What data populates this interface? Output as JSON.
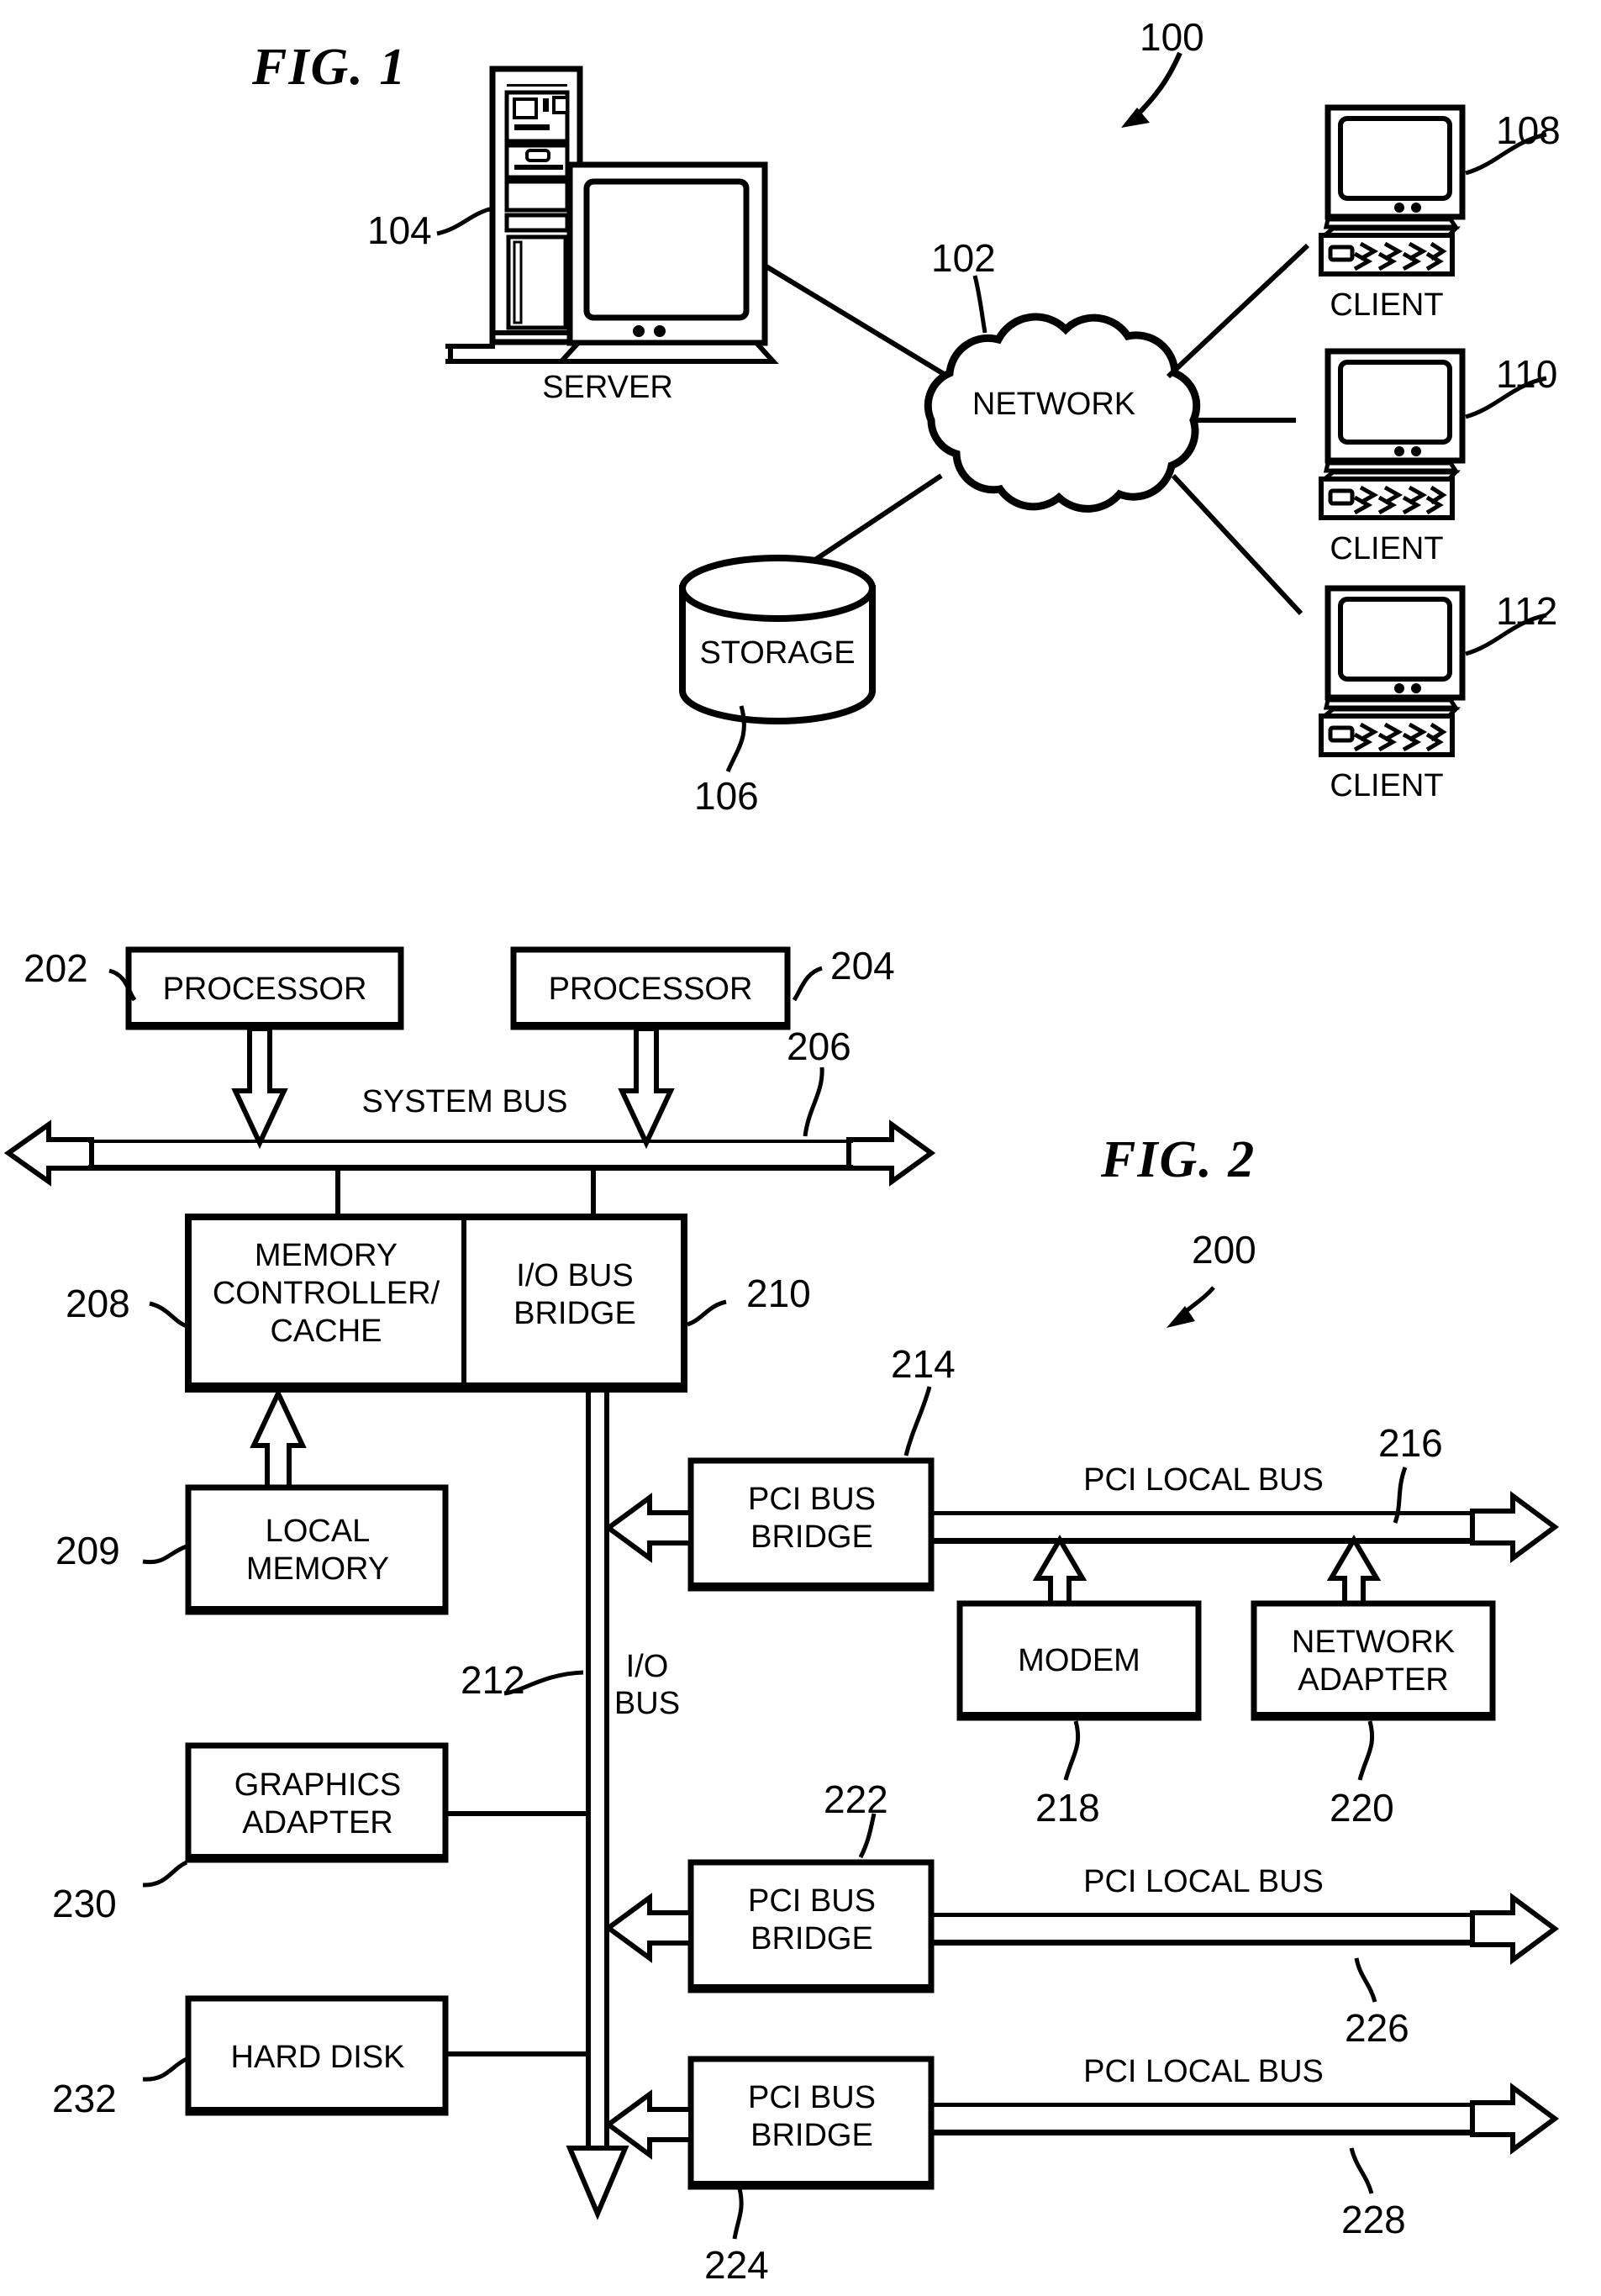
{
  "document": {
    "type": "patent-drawing-sheet",
    "figures": [
      "FIG. 1",
      "FIG. 2"
    ]
  },
  "fig1": {
    "title": "FIG. 1",
    "system_ref": "100",
    "nodes": {
      "server": {
        "caption": "SERVER",
        "ref": "104"
      },
      "network": {
        "caption": "NETWORK",
        "ref": "102"
      },
      "storage": {
        "caption": "STORAGE",
        "ref": "106"
      },
      "client1": {
        "caption": "CLIENT",
        "ref": "108"
      },
      "client2": {
        "caption": "CLIENT",
        "ref": "110"
      },
      "client3": {
        "caption": "CLIENT",
        "ref": "112"
      }
    }
  },
  "fig2": {
    "title": "FIG. 2",
    "system_ref": "200",
    "blocks": {
      "processor1": {
        "label": "PROCESSOR",
        "ref": "202"
      },
      "processor2": {
        "label": "PROCESSOR",
        "ref": "204"
      },
      "memory_controller": {
        "label_line1": "MEMORY",
        "label_line2": "CONTROLLER/",
        "label_line3": "CACHE",
        "ref": "208"
      },
      "io_bus_bridge": {
        "label_line1": "I/O BUS",
        "label_line2": "BRIDGE",
        "ref": "210"
      },
      "local_memory": {
        "label_line1": "LOCAL",
        "label_line2": "MEMORY",
        "ref": "209"
      },
      "pci_bus_bridge_1": {
        "label_line1": "PCI BUS",
        "label_line2": "BRIDGE",
        "ref": "214"
      },
      "pci_bus_bridge_2": {
        "label_line1": "PCI BUS",
        "label_line2": "BRIDGE",
        "ref": "222"
      },
      "pci_bus_bridge_3": {
        "label_line1": "PCI BUS",
        "label_line2": "BRIDGE",
        "ref": "224"
      },
      "modem": {
        "label": "MODEM",
        "ref": "218"
      },
      "network_adapter": {
        "label_line1": "NETWORK",
        "label_line2": "ADAPTER",
        "ref": "220"
      },
      "graphics_adapter": {
        "label_line1": "GRAPHICS",
        "label_line2": "ADAPTER",
        "ref": "230"
      },
      "hard_disk": {
        "label": "HARD DISK",
        "ref": "232"
      }
    },
    "buses": {
      "system_bus": {
        "label": "SYSTEM BUS",
        "ref": "206"
      },
      "io_bus": {
        "label_line1": "I/O",
        "label_line2": "BUS",
        "ref": "212"
      },
      "pci_local_bus_1": {
        "label": "PCI LOCAL BUS",
        "ref": "216"
      },
      "pci_local_bus_2": {
        "label": "PCI LOCAL BUS",
        "ref": "226"
      },
      "pci_local_bus_3": {
        "label": "PCI LOCAL BUS",
        "ref": "228"
      }
    }
  },
  "style": {
    "ink": "#000000",
    "paper": "#ffffff"
  }
}
